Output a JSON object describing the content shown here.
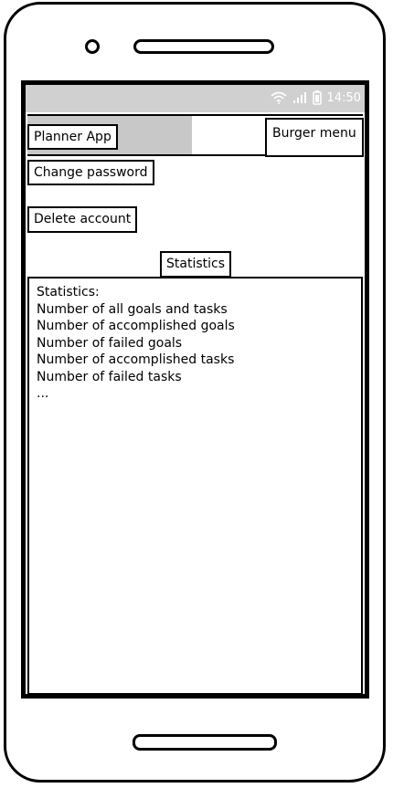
{
  "status_bar": {
    "time": "14:50",
    "icons": [
      "wifi-icon",
      "signal-icon",
      "battery-icon"
    ]
  },
  "header": {
    "app_title": "Planner App",
    "menu_label": "Burger menu"
  },
  "actions": {
    "change_password": "Change password",
    "delete_account": "Delete account",
    "statistics": "Statistics"
  },
  "statistics_panel": {
    "lines": [
      "Statistics:",
      "Number of all goals and tasks",
      "Number of accomplished goals",
      "Number of failed goals",
      "Number of accomplished tasks",
      "Number of failed tasks",
      "..."
    ]
  },
  "colors": {
    "status_bar_bg": "#d0d0d0",
    "header_highlight": "#c8c8c8",
    "outline": "#000000"
  }
}
